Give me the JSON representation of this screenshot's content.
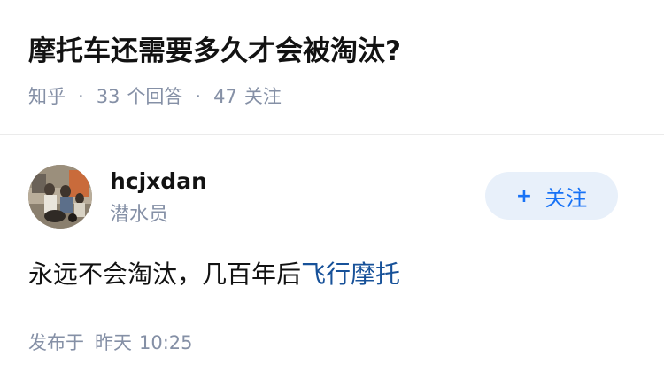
{
  "question": {
    "title": "摩托车还需要多久才会被淘汰?",
    "source": "知乎",
    "answer_count": "33",
    "answer_label": "个回答",
    "follow_count": "47",
    "follow_label": "关注"
  },
  "answer": {
    "author": {
      "name": "hcjxdan",
      "badge": "潜水员",
      "avatar_icon": "user-avatar-photo"
    },
    "follow_button": {
      "icon": "+",
      "label": "关注"
    },
    "content": {
      "text": "永远不会淘汰，几百年后",
      "link_text": "飞行摩托"
    },
    "time": {
      "label": "发布于",
      "day": "昨天",
      "clock": "10:25"
    }
  },
  "colors": {
    "meta_gray": "#8590a6",
    "link_blue": "#175199",
    "button_bg": "#e8f0fa",
    "button_text": "#1772f6",
    "divider": "#ebebeb"
  }
}
